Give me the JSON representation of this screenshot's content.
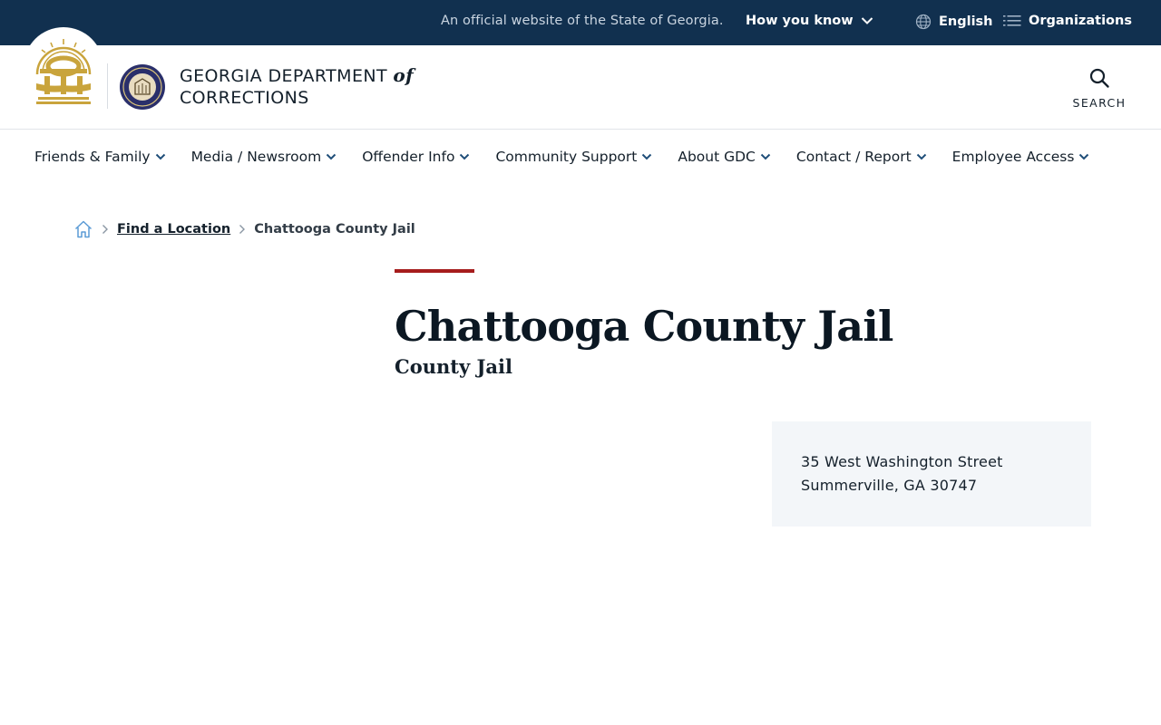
{
  "topbar": {
    "official_text": "An official website of the State of Georgia.",
    "how_you_know": "How you know",
    "language": "English",
    "organizations": "Organizations"
  },
  "header": {
    "brand_line1_a": "GEORGIA DEPARTMENT",
    "brand_line1_of": "of",
    "brand_line2": "CORRECTIONS",
    "search_label": "SEARCH"
  },
  "nav": {
    "items": [
      {
        "label": "Friends & Family"
      },
      {
        "label": "Media / Newsroom"
      },
      {
        "label": "Offender Info"
      },
      {
        "label": "Community Support"
      },
      {
        "label": "About GDC"
      },
      {
        "label": "Contact / Report"
      },
      {
        "label": "Employee Access"
      }
    ]
  },
  "breadcrumb": {
    "link": "Find a Location",
    "current": "Chattooga County Jail"
  },
  "page": {
    "title": "Chattooga County Jail",
    "subtitle": "County Jail",
    "address_line1": "35 West Washington Street",
    "address_line2": "Summerville, GA 30747"
  },
  "colors": {
    "topbar_bg": "#11304f",
    "accent_red": "#a61c1c",
    "gold": "#c9a43c",
    "nav_chevron": "#1f4e79",
    "card_bg": "#f3f6f9"
  },
  "icons": [
    "chevron-down-icon",
    "globe-icon",
    "list-icon",
    "search-icon",
    "home-icon",
    "chevron-right-icon"
  ]
}
